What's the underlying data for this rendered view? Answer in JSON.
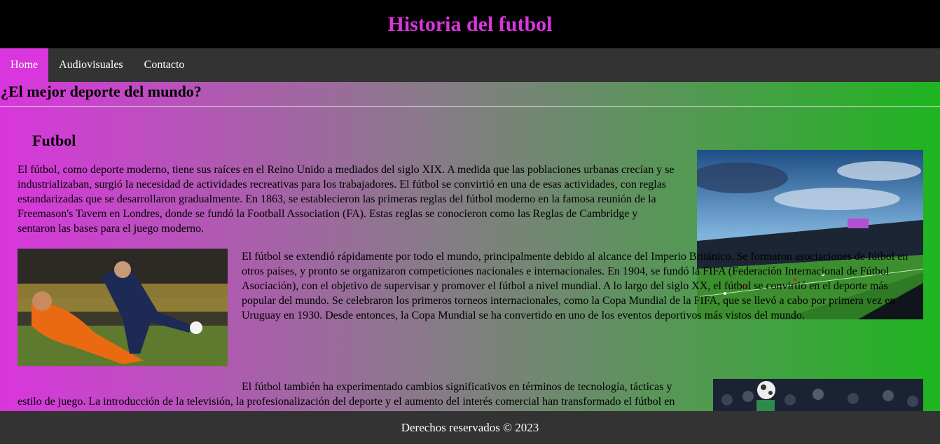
{
  "header": {
    "title": "Historia del futbol"
  },
  "nav": {
    "items": [
      {
        "label": "Home",
        "active": true
      },
      {
        "label": "Audiovisuales",
        "active": false
      },
      {
        "label": "Contacto",
        "active": false
      }
    ]
  },
  "section": {
    "heading": "¿El mejor deporte del mundo?"
  },
  "article": {
    "title": "Futbol",
    "paragraphs": [
      "El fútbol, como deporte moderno, tiene sus raíces en el Reino Unido a mediados del siglo XIX. A medida que las poblaciones urbanas crecían y se industrializaban, surgió la necesidad de actividades recreativas para los trabajadores. El fútbol se convirtió en una de esas actividades, con reglas estandarizadas que se desarrollaron gradualmente. En 1863, se establecieron las primeras reglas del fútbol moderno en la famosa reunión de la Freemason's Tavern en Londres, donde se fundó la Football Association (FA). Estas reglas se conocieron como las Reglas de Cambridge y sentaron las bases para el juego moderno.",
      "El fútbol se extendió rápidamente por todo el mundo, principalmente debido al alcance del Imperio Británico. Se formaron asociaciones de fútbol en otros países, y pronto se organizaron competiciones nacionales e internacionales. En 1904, se fundó la FIFA (Federación Internacional de Fútbol Asociación), con el objetivo de supervisar y promover el fútbol a nivel mundial. A lo largo del siglo XX, el fútbol se convirtió en el deporte más popular del mundo. Se celebraron los primeros torneos internacionales, como la Copa Mundial de la FIFA, que se llevó a cabo por primera vez en Uruguay en 1930. Desde entonces, la Copa Mundial se ha convertido en uno de los eventos deportivos más vistos del mundo.",
      "El fútbol también ha experimentado cambios significativos en términos de tecnología, tácticas y estilo de juego. La introducción de la televisión, la profesionalización del deporte y el aumento del interés comercial han transformado el fútbol en un fenómeno global."
    ]
  },
  "footer": {
    "text": "Derechos reservados © 2023"
  },
  "colors": {
    "accent": "#d936dd",
    "header_bg": "#000000",
    "nav_bg": "#333333",
    "gradient_end": "#1fb51f"
  }
}
